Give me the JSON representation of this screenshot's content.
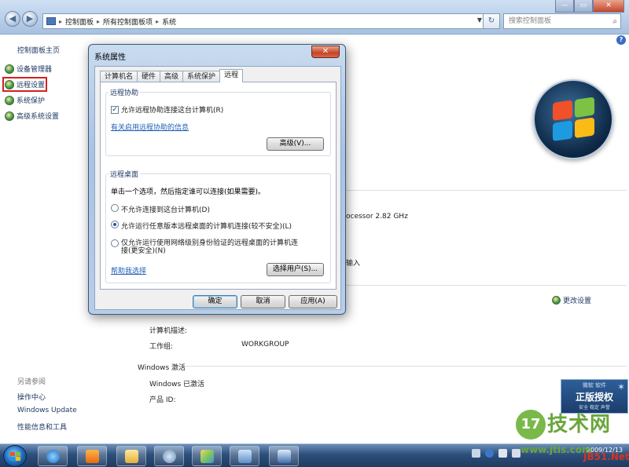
{
  "explorer": {
    "breadcrumb": [
      "控制面板",
      "所有控制面板项",
      "系统"
    ],
    "search_placeholder": "搜索控制面板",
    "refresh_label": "↻",
    "window_controls": [
      "—",
      "▭",
      "✕"
    ]
  },
  "left_pane": {
    "home": "控制面板主页",
    "items": [
      "设备管理器",
      "远程设置",
      "系统保护",
      "高级系统设置"
    ],
    "see_also_title": "另请参阅",
    "see_also": [
      "操作中心",
      "Windows Update",
      "性能信息和工具"
    ]
  },
  "main": {
    "processor_text": "ocessor  2.82 GHz",
    "partial_text": "输入",
    "computer_desc_label": "计算机描述:",
    "workgroup_label": "工作组:",
    "workgroup_value": "WORKGROUP",
    "change_settings": "更改设置",
    "activation_title": "Windows 激活",
    "activated": "Windows 已激活",
    "product_id": "产品 ID:",
    "genuine_line1": "微软 软件",
    "genuine_line2": "正版授权",
    "genuine_line3": "安全 稳定 声誉"
  },
  "dialog": {
    "title": "系统属性",
    "close_label": "✕",
    "tabs": [
      "计算机名",
      "硬件",
      "高级",
      "系统保护",
      "远程"
    ],
    "remote_assistance": {
      "title": "远程协助",
      "checkbox_label": "允许远程协助连接这台计算机(R)",
      "checked": true,
      "link": "有关启用远程协助的信息",
      "advanced_button": "高级(V)..."
    },
    "remote_desktop": {
      "title": "远程桌面",
      "description": "单击一个选项，然后指定谁可以连接(如果需要)。",
      "options": [
        "不允许连接到这台计算机(D)",
        "允许运行任意版本远程桌面的计算机连接(较不安全)(L)",
        "仅允许运行使用网络级别身份验证的远程桌面的计算机连接(更安全)(N)"
      ],
      "selected_index": 1,
      "help_link": "帮助我选择",
      "select_users_button": "选择用户(S)..."
    },
    "buttons": {
      "ok": "确定",
      "cancel": "取消",
      "apply": "应用(A)"
    }
  },
  "taskbar": {
    "clock": "2009/12/13"
  },
  "watermark": {
    "logo_char": "17",
    "text": "技术网",
    "url": "www.jtis.com",
    "site": "JB51.Net"
  },
  "colors": {
    "accent_blue": "#1f5fb5",
    "highlight_red": "#d42020",
    "watermark_green": "#6aa63c"
  }
}
